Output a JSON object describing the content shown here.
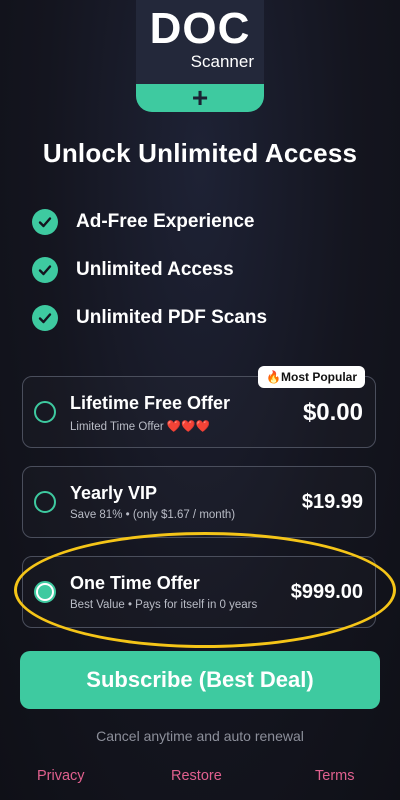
{
  "logo": {
    "title": "DOC",
    "subtitle": "Scanner",
    "plus": "+"
  },
  "headline": "Unlock Unlimited Access",
  "features": [
    {
      "label": "Ad-Free Experience"
    },
    {
      "label": "Unlimited Access"
    },
    {
      "label": "Unlimited PDF Scans"
    }
  ],
  "plans": [
    {
      "title": "Lifetime Free Offer",
      "subtitle": "Limited Time Offer ❤️❤️❤️",
      "price": "$0.00",
      "badge": "🔥Most Popular",
      "selected": false
    },
    {
      "title": "Yearly VIP",
      "subtitle": "Save 81% • (only $1.67 / month)",
      "price": "$19.99",
      "selected": false
    },
    {
      "title": "One Time Offer",
      "subtitle": "Best Value • Pays for itself in 0 years",
      "price": "$999.00",
      "selected": true
    }
  ],
  "cta": {
    "label": "Subscribe (Best Deal)"
  },
  "fineprint": "Cancel anytime and auto renewal",
  "footer": {
    "privacy": "Privacy",
    "restore": "Restore",
    "terms": "Terms"
  },
  "colors": {
    "accent": "#3ecaa0",
    "highlight": "#f5c518",
    "link": "#e0608e",
    "background": "#14151f"
  }
}
